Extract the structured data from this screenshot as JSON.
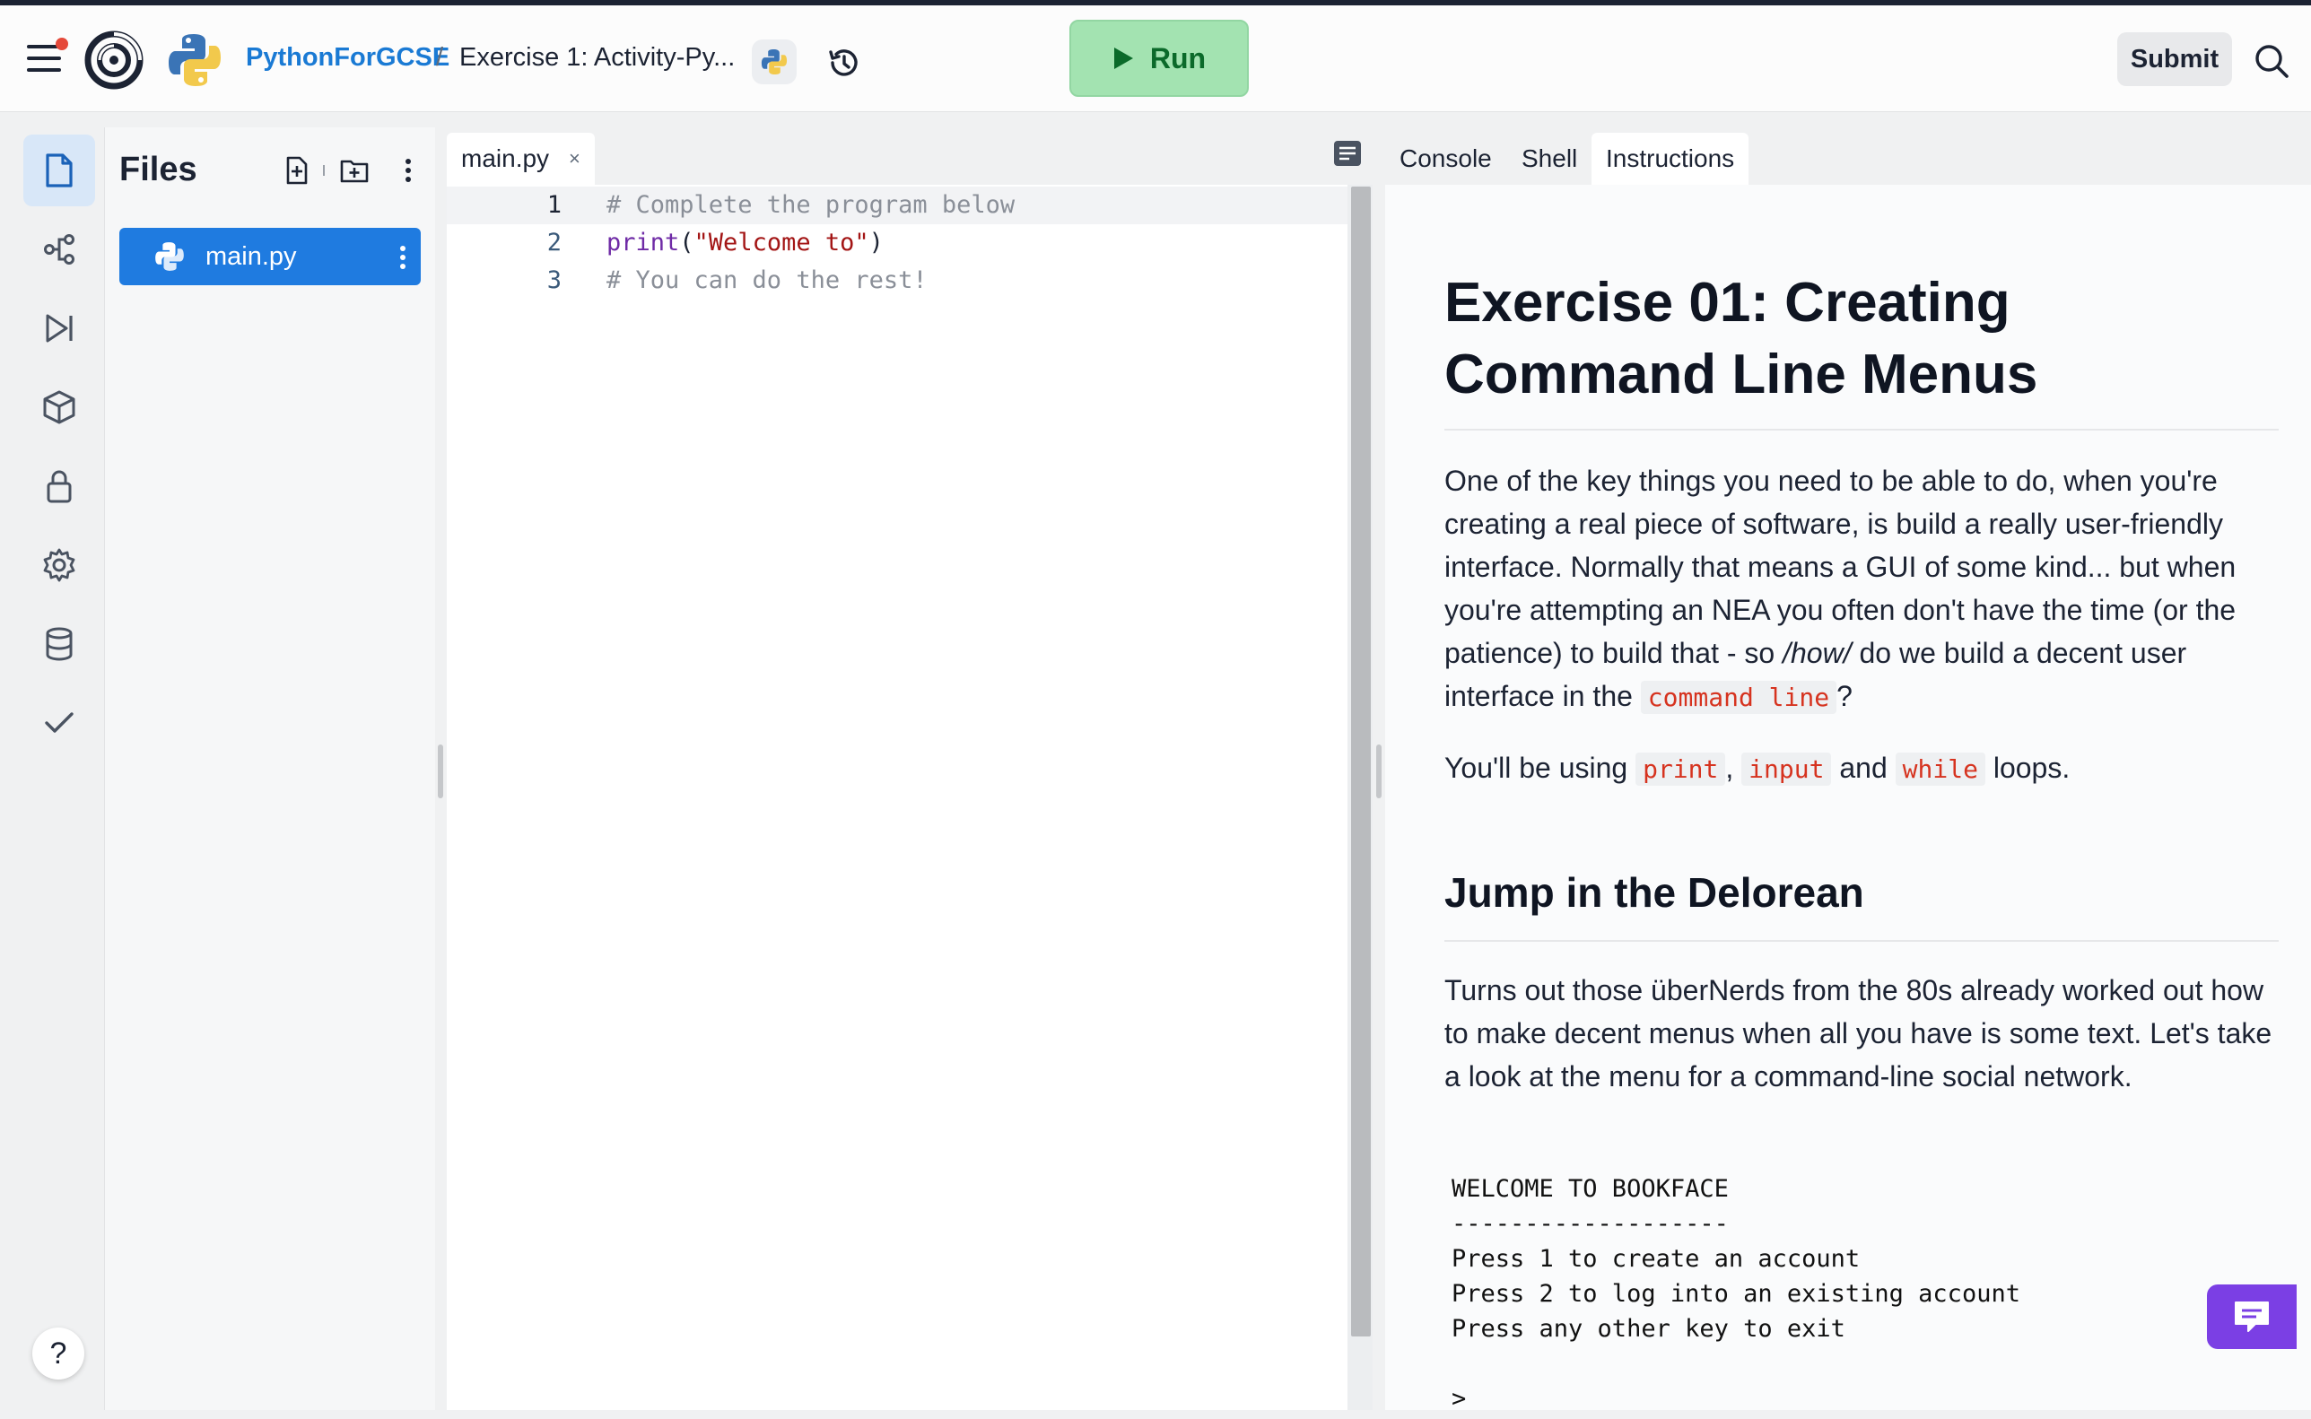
{
  "header": {
    "repl_owner": "PythonForGCSE",
    "separator": "/",
    "repl_title": "Exercise 1: Activity-Py...",
    "run_label": "Run",
    "submit_label": "Submit",
    "icons": [
      "menu-icon",
      "replit-logo",
      "python-logo",
      "python-language-icon",
      "history-icon",
      "search-icon"
    ],
    "run_color": "#a3e3b1"
  },
  "rail": {
    "items": [
      "files-icon",
      "git-icon",
      "debugger-icon",
      "packages-icon",
      "secrets-icon",
      "settings-icon",
      "database-icon",
      "tests-check-icon"
    ],
    "help_label": "?"
  },
  "files": {
    "title": "Files",
    "items": [
      {
        "name": "main.py",
        "selected": true
      }
    ],
    "accent": "#1f7be0"
  },
  "editor": {
    "tab_label": "main.py",
    "tab_close": "×",
    "lines": [
      {
        "number": "1",
        "text": "# Complete the program below"
      },
      {
        "number": "2",
        "kw": "print",
        "open": "(",
        "str": "\"Welcome to\"",
        "close": ")"
      },
      {
        "number": "3",
        "text": "# You can do the rest!"
      }
    ]
  },
  "right_tabs": [
    {
      "label": "Console",
      "active": false
    },
    {
      "label": "Shell",
      "active": false
    },
    {
      "label": "Instructions",
      "active": true
    }
  ],
  "instructions": {
    "title": "Exercise 01: Creating Command Line Menus",
    "p1": {
      "before": "One of the key things you need to be able to do, when you're creating a real piece of software, is build a really user-friendly interface. Normally that means a GUI of some kind... but when you're attempting an NEA you often don't have the time (or the patience) to build that - so ",
      "em": "/how/",
      "middle": " do we build a decent user interface in the ",
      "code": "command line",
      "after": "?"
    },
    "p2": {
      "before": "You'll be using ",
      "code1": "print",
      "sep1": ", ",
      "code2": "input",
      "sep2": " and ",
      "code3": "while",
      "after": " loops."
    },
    "subheading": "Jump in the Delorean",
    "p3": "Turns out those überNerds from the 80s already worked out how to make decent menus when all you have is some text. Let's take a look at the menu for a command-line social network.",
    "menu_block": "WELCOME TO BOOKFACE\n-------------------\nPress 1 to create an account\nPress 2 to log into an existing account\nPress any other key to exit\n\n>"
  },
  "chat_icon": "chat-icon"
}
